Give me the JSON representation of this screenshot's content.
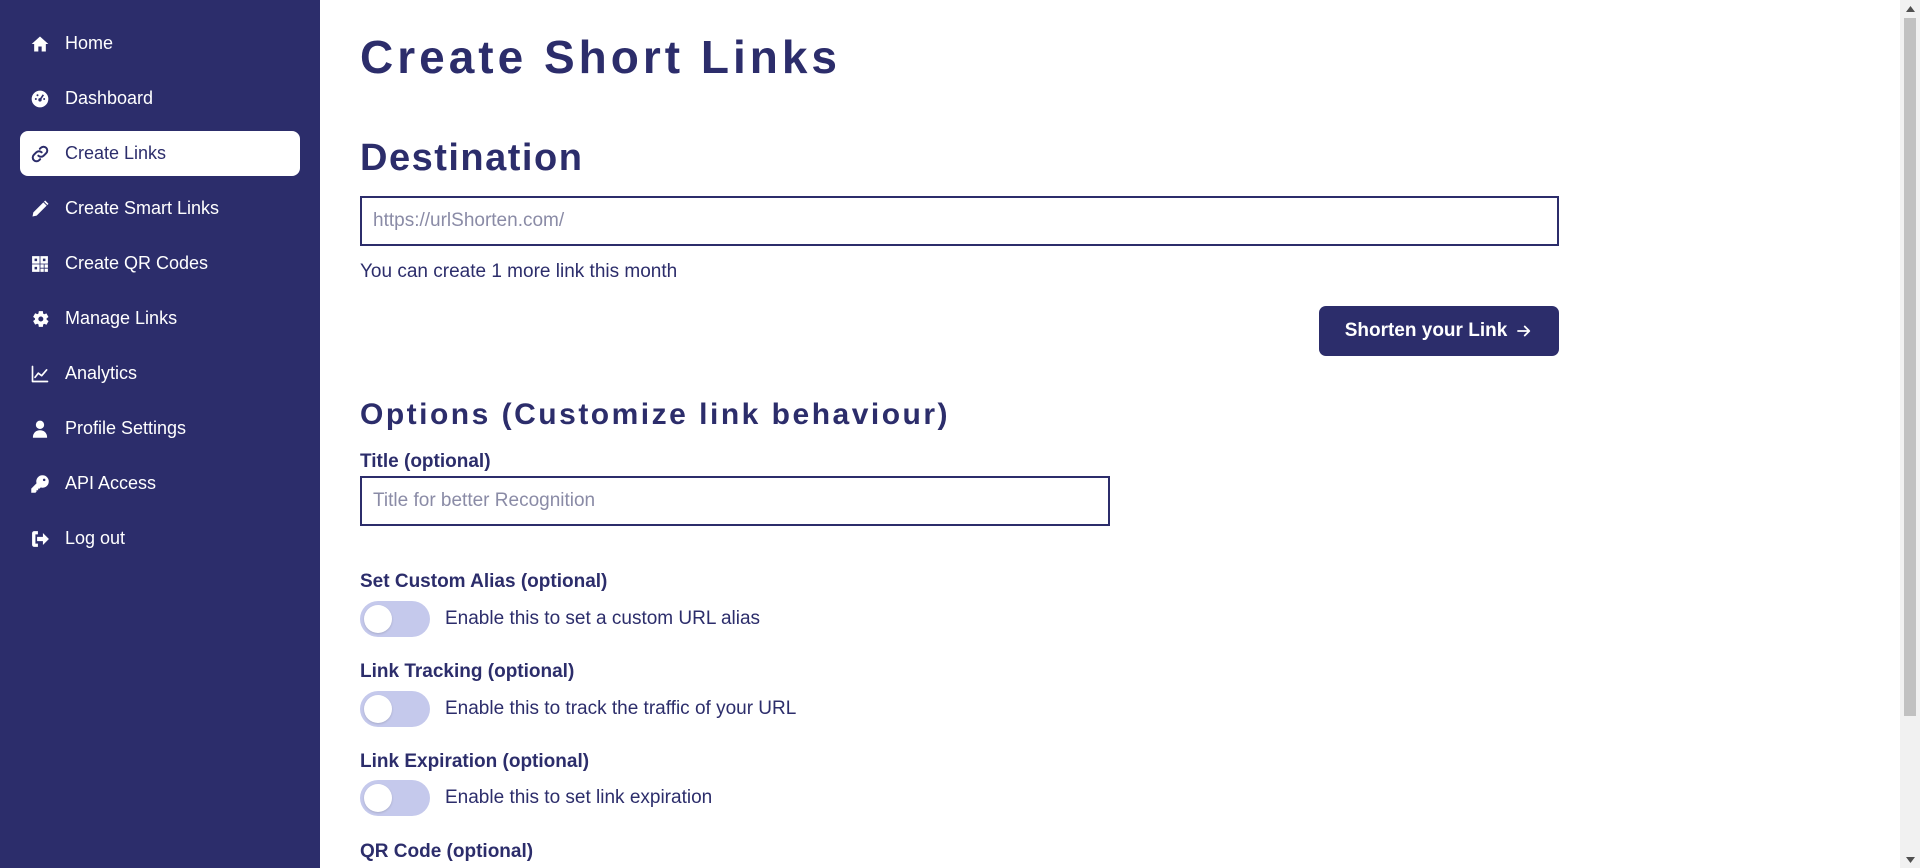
{
  "sidebar": {
    "items": [
      {
        "label": "Home",
        "icon": "home-icon",
        "active": false
      },
      {
        "label": "Dashboard",
        "icon": "dashboard-gauge-icon",
        "active": false
      },
      {
        "label": "Create Links",
        "icon": "link-icon",
        "active": true
      },
      {
        "label": "Create Smart Links",
        "icon": "pencil-icon",
        "active": false
      },
      {
        "label": "Create QR Codes",
        "icon": "qr-code-icon",
        "active": false
      },
      {
        "label": "Manage Links",
        "icon": "gear-icon",
        "active": false
      },
      {
        "label": "Analytics",
        "icon": "line-chart-icon",
        "active": false
      },
      {
        "label": "Profile Settings",
        "icon": "user-icon",
        "active": false
      },
      {
        "label": "API Access",
        "icon": "key-icon",
        "active": false
      },
      {
        "label": "Log out",
        "icon": "logout-icon",
        "active": false
      }
    ]
  },
  "main": {
    "page_title": "Create Short Links",
    "destination": {
      "heading": "Destination",
      "placeholder": "https://urlShorten.com/",
      "value": "",
      "hint": "You can create 1 more link this month",
      "button_label": "Shorten your Link"
    },
    "options": {
      "heading": "Options (Customize link behaviour)",
      "title_label": "Title (optional)",
      "title_placeholder": "Title for better Recognition",
      "custom_alias": {
        "label": "Set Custom Alias (optional)",
        "text": "Enable this to set a custom URL alias",
        "enabled": false
      },
      "link_tracking": {
        "label": "Link Tracking (optional)",
        "text": "Enable this to track the traffic of your URL",
        "enabled": false
      },
      "link_expiration": {
        "label": "Link Expiration (optional)",
        "text": "Enable this to set link expiration",
        "enabled": false
      },
      "qr_code": {
        "label": "QR Code (optional)"
      }
    }
  },
  "colors": {
    "primary": "#2c2d6b",
    "toggle_off": "#c5c9ec",
    "background": "#ffffff"
  }
}
